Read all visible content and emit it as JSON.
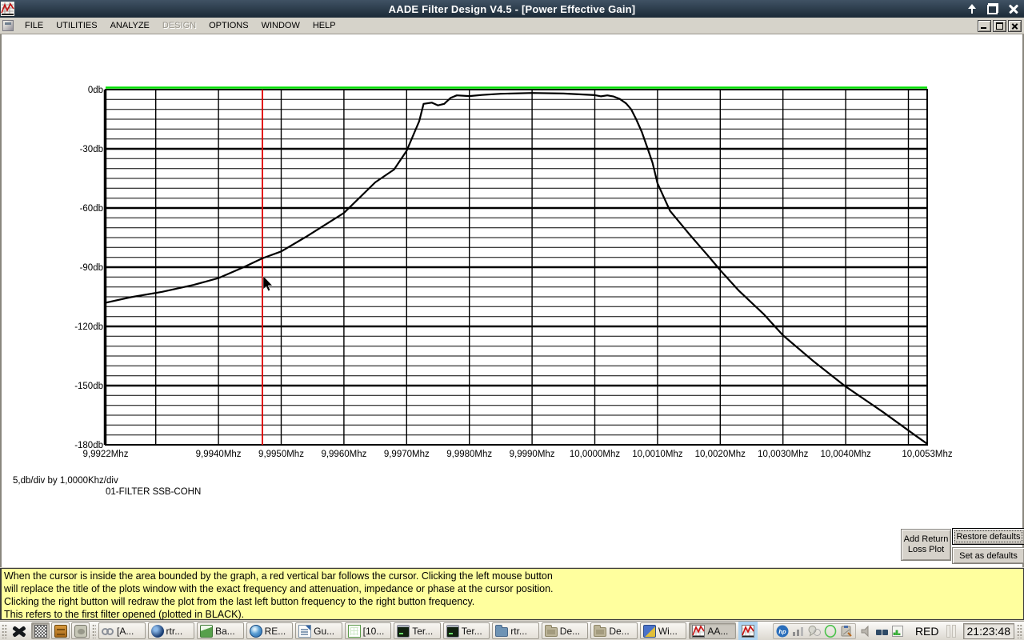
{
  "window": {
    "title": "AADE Filter Design V4.5 - [Power Effective Gain]",
    "titlebar_controls": [
      {
        "name": "shade-up-icon"
      },
      {
        "name": "restore-icon"
      },
      {
        "name": "close-icon"
      }
    ],
    "mdi_controls": [
      {
        "name": "minimize-icon"
      },
      {
        "name": "restore-icon"
      },
      {
        "name": "close-icon"
      }
    ],
    "menu": {
      "items": [
        {
          "label": "FILE",
          "enabled": true
        },
        {
          "label": "UTILITIES",
          "enabled": true
        },
        {
          "label": "ANALYZE",
          "enabled": true
        },
        {
          "label": "DESIGN",
          "enabled": false
        },
        {
          "label": "OPTIONS",
          "enabled": true
        },
        {
          "label": "WINDOW",
          "enabled": true
        },
        {
          "label": "HELP",
          "enabled": true
        }
      ]
    }
  },
  "chart_data": {
    "type": "line",
    "title": "01-FILTER SSB-COHN",
    "scale_note": "5,db/div by 1,0000Khz/div",
    "x_unit": "Mhz",
    "y_unit": "db",
    "xlim": [
      9.9922,
      10.0053
    ],
    "ylim": [
      -180,
      0
    ],
    "x_grid": {
      "start": 9.993,
      "step": 0.001,
      "count": 13
    },
    "y_grid": {
      "step": 5,
      "major_every": 30
    },
    "x_ticks": [
      {
        "v": 9.9922,
        "label": "9,9922Mhz"
      },
      {
        "v": 9.994,
        "label": "9,9940Mhz"
      },
      {
        "v": 9.995,
        "label": "9,9950Mhz"
      },
      {
        "v": 9.996,
        "label": "9,9960Mhz"
      },
      {
        "v": 9.997,
        "label": "9,9970Mhz"
      },
      {
        "v": 9.998,
        "label": "9,9980Mhz"
      },
      {
        "v": 9.999,
        "label": "9,9990Mhz"
      },
      {
        "v": 10.0,
        "label": "10,0000Mhz"
      },
      {
        "v": 10.001,
        "label": "10,0010Mhz"
      },
      {
        "v": 10.002,
        "label": "10,0020Mhz"
      },
      {
        "v": 10.003,
        "label": "10,0030Mhz"
      },
      {
        "v": 10.004,
        "label": "10,0040Mhz"
      },
      {
        "v": 10.0053,
        "label": "10,0053Mhz"
      }
    ],
    "y_ticks": [
      {
        "v": 0,
        "label": "0db"
      },
      {
        "v": -30,
        "label": "-30db"
      },
      {
        "v": -60,
        "label": "-60db"
      },
      {
        "v": -90,
        "label": "-90db"
      },
      {
        "v": -120,
        "label": "-120db"
      },
      {
        "v": -150,
        "label": "-150db"
      },
      {
        "v": -180,
        "label": "-180db"
      }
    ],
    "reference_line": {
      "y": 0,
      "color": "#00e100"
    },
    "cursor_line": {
      "x": 9.9947,
      "color": "#e00000"
    },
    "series": [
      {
        "name": "Power Effective Gain (first filter, BLACK)",
        "color": "#000000",
        "points": [
          [
            9.9922,
            -108
          ],
          [
            9.9926,
            -105.2
          ],
          [
            9.9931,
            -102.5
          ],
          [
            9.9936,
            -99
          ],
          [
            9.994,
            -95.5
          ],
          [
            9.9944,
            -90
          ],
          [
            9.9947,
            -85.5
          ],
          [
            9.995,
            -82
          ],
          [
            9.9954,
            -74.5
          ],
          [
            9.996,
            -62.5
          ],
          [
            9.9965,
            -47
          ],
          [
            9.9968,
            -40.5
          ],
          [
            9.997,
            -31
          ],
          [
            9.9972,
            -16
          ],
          [
            9.99727,
            -7.2
          ],
          [
            9.9974,
            -6.6
          ],
          [
            9.9975,
            -8
          ],
          [
            9.9976,
            -7.2
          ],
          [
            9.9977,
            -4.2
          ],
          [
            9.9978,
            -2.9
          ],
          [
            9.998,
            -3.3
          ],
          [
            9.9982,
            -2.7
          ],
          [
            9.9985,
            -2.1
          ],
          [
            9.999,
            -1.7
          ],
          [
            9.9995,
            -2
          ],
          [
            10.0,
            -2.8
          ],
          [
            10.0001,
            -3.4
          ],
          [
            10.0002,
            -2.9
          ],
          [
            10.0003,
            -3.5
          ],
          [
            10.0004,
            -4.8
          ],
          [
            10.0005,
            -7
          ],
          [
            10.00058,
            -10
          ],
          [
            10.00066,
            -15
          ],
          [
            10.00075,
            -21.5
          ],
          [
            10.00085,
            -30.5
          ],
          [
            10.00092,
            -37
          ],
          [
            10.001,
            -47.5
          ],
          [
            10.0012,
            -61.5
          ],
          [
            10.0015,
            -73
          ],
          [
            10.0018,
            -84
          ],
          [
            10.002,
            -91.5
          ],
          [
            10.0023,
            -102
          ],
          [
            10.0027,
            -114
          ],
          [
            10.003,
            -124.5
          ],
          [
            10.0035,
            -138
          ],
          [
            10.004,
            -150.5
          ],
          [
            10.0046,
            -163.5
          ],
          [
            10.0051,
            -175
          ],
          [
            10.0053,
            -179.5
          ]
        ]
      }
    ]
  },
  "side_buttons": {
    "add_return_loss": "Add Return\nLoss Plot",
    "restore_defaults": "Restore defaults",
    "set_as_defaults": "Set as defaults"
  },
  "help_box": {
    "background": "#ffff9e",
    "lines": [
      "When the cursor is inside the area bounded by the graph, a red vertical bar follows the cursor. Clicking the left mouse button",
      "will replace the title of the plots window with the exact frequency and attenuation, impedance or phase at the cursor position.",
      "Clicking the right button will redraw the plot from the last left button frequency to the right button frequency.",
      "This refers to the first filter opened (plotted in BLACK)."
    ]
  },
  "taskbar": {
    "logo_icon": "xlogo",
    "launchers": [
      {
        "icon": "dither",
        "active": true
      },
      {
        "icon": "drawer",
        "active": false
      },
      {
        "icon": "desktop",
        "active": false
      }
    ],
    "windows": [
      {
        "icon": "glasses",
        "label": "[A...",
        "active": false
      },
      {
        "icon": "orbit",
        "label": "rtr...",
        "active": false
      },
      {
        "icon": "image",
        "label": "Ba...",
        "active": false
      },
      {
        "icon": "globe",
        "label": "RE...",
        "active": false
      },
      {
        "icon": "writer",
        "label": "Gu...",
        "active": false
      },
      {
        "icon": "calc",
        "label": "[10...",
        "active": false
      },
      {
        "icon": "terminal",
        "label": "Ter...",
        "active": false
      },
      {
        "icon": "terminal",
        "label": "Ter...",
        "active": false
      },
      {
        "icon": "folder-blue",
        "label": "rtr...",
        "active": false
      },
      {
        "icon": "folder-tan",
        "label": "De...",
        "active": false
      },
      {
        "icon": "folder-tan",
        "label": "De...",
        "active": false
      },
      {
        "icon": "wine",
        "label": "Wi...",
        "active": false
      },
      {
        "icon": "aade",
        "label": "AA...",
        "active": true
      }
    ],
    "tray_highlight_icon": "aade",
    "tray_group_icons": [
      "hp",
      "signal",
      "chat",
      "oval",
      "clipboard"
    ],
    "tray_plain_icons": [
      "speaker",
      "squares",
      "cpugraph"
    ],
    "status_label": "RED",
    "clock": "21:23:48"
  }
}
